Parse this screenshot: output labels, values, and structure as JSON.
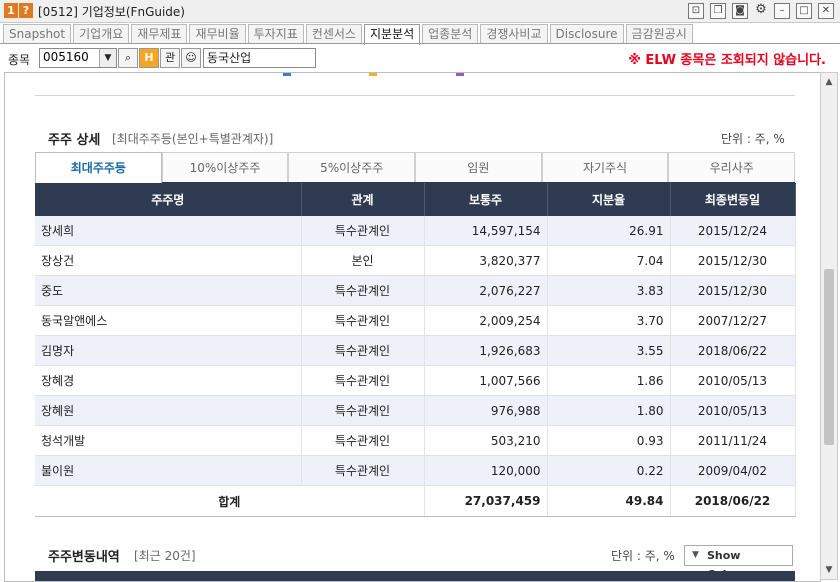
{
  "window": {
    "number": "1",
    "help": "?",
    "title": "[0512] 기업정보(FnGuide)",
    "icons": [
      "pin-icon",
      "copy-icon",
      "camera-icon",
      "gear-icon",
      "minimize-icon",
      "maximize-icon",
      "close-icon"
    ]
  },
  "tabs": [
    "Snapshot",
    "기업개요",
    "재무제표",
    "재무비율",
    "투자지표",
    "컨센서스",
    "지분분석",
    "업종분석",
    "경쟁사비교",
    "Disclosure",
    "금감원공시"
  ],
  "active_tab": "지분분석",
  "search": {
    "label": "종목",
    "code": "005160",
    "h_button": "H",
    "gwan_button": "관",
    "company_name": "동국산업",
    "warning": "※ ELW 종목은 조회되지 않습니다."
  },
  "legend_colors": [
    "#3e7ccc",
    "#f1b12c",
    "#9a5bb8"
  ],
  "shareholders": {
    "title": "주주 상세",
    "subtitle": "[최대주주등(본인+특별관계자)]",
    "unit": "단위 : 주, %",
    "subtabs": [
      "최대주주등",
      "10%이상주주",
      "5%이상주주",
      "임원",
      "자기주식",
      "우리사주"
    ],
    "active_subtab": "최대주주등",
    "columns": [
      "주주명",
      "관계",
      "보통주",
      "지분율",
      "최종변동일"
    ],
    "rows": [
      {
        "name": "장세희",
        "relation": "특수관계인",
        "shares": "14,597,154",
        "ratio": "26.91",
        "date": "2015/12/24"
      },
      {
        "name": "장상건",
        "relation": "본인",
        "shares": "3,820,377",
        "ratio": "7.04",
        "date": "2015/12/30"
      },
      {
        "name": "중도",
        "relation": "특수관계인",
        "shares": "2,076,227",
        "ratio": "3.83",
        "date": "2015/12/30"
      },
      {
        "name": "동국알앤에스",
        "relation": "특수관계인",
        "shares": "2,009,254",
        "ratio": "3.70",
        "date": "2007/12/27"
      },
      {
        "name": "김명자",
        "relation": "특수관계인",
        "shares": "1,926,683",
        "ratio": "3.55",
        "date": "2018/06/22"
      },
      {
        "name": "장혜경",
        "relation": "특수관계인",
        "shares": "1,007,566",
        "ratio": "1.86",
        "date": "2010/05/13"
      },
      {
        "name": "장혜원",
        "relation": "특수관계인",
        "shares": "976,988",
        "ratio": "1.80",
        "date": "2010/05/13"
      },
      {
        "name": "청석개발",
        "relation": "특수관계인",
        "shares": "503,210",
        "ratio": "0.93",
        "date": "2011/11/24"
      },
      {
        "name": "불이원",
        "relation": "특수관계인",
        "shares": "120,000",
        "ratio": "0.22",
        "date": "2009/04/02"
      }
    ],
    "total": {
      "label": "합계",
      "shares": "27,037,459",
      "ratio": "49.84",
      "date": "2018/06/22"
    }
  },
  "changes": {
    "title": "주주변동내역",
    "subtitle": "[최근 20건]",
    "unit": "단위 : 주, %",
    "show_columns": "Show Columns"
  }
}
